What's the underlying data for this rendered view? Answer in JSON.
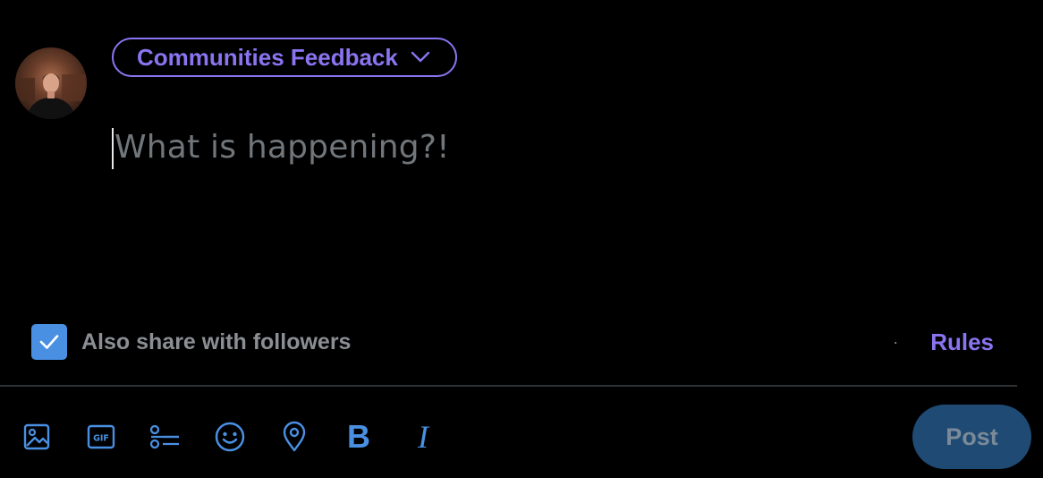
{
  "audience": {
    "community_name": "Communities Feedback",
    "chevron_icon": "chevron-down-icon"
  },
  "composer": {
    "placeholder": "What is happening?!"
  },
  "share": {
    "label": "Also share with followers",
    "checked": true,
    "separator": "·",
    "rules_label": "Rules"
  },
  "toolbar": {
    "tools": [
      "image-icon",
      "gif-icon",
      "poll-icon",
      "emoji-icon",
      "location-icon",
      "bold-icon",
      "italic-icon"
    ],
    "bold_glyph": "B",
    "italic_glyph": "I"
  },
  "post": {
    "label": "Post",
    "enabled": false
  },
  "colors": {
    "accent_purple": "#8a74f0",
    "accent_blue": "#4a90e2",
    "background": "#000000",
    "post_disabled_bg": "#1f4a73"
  }
}
